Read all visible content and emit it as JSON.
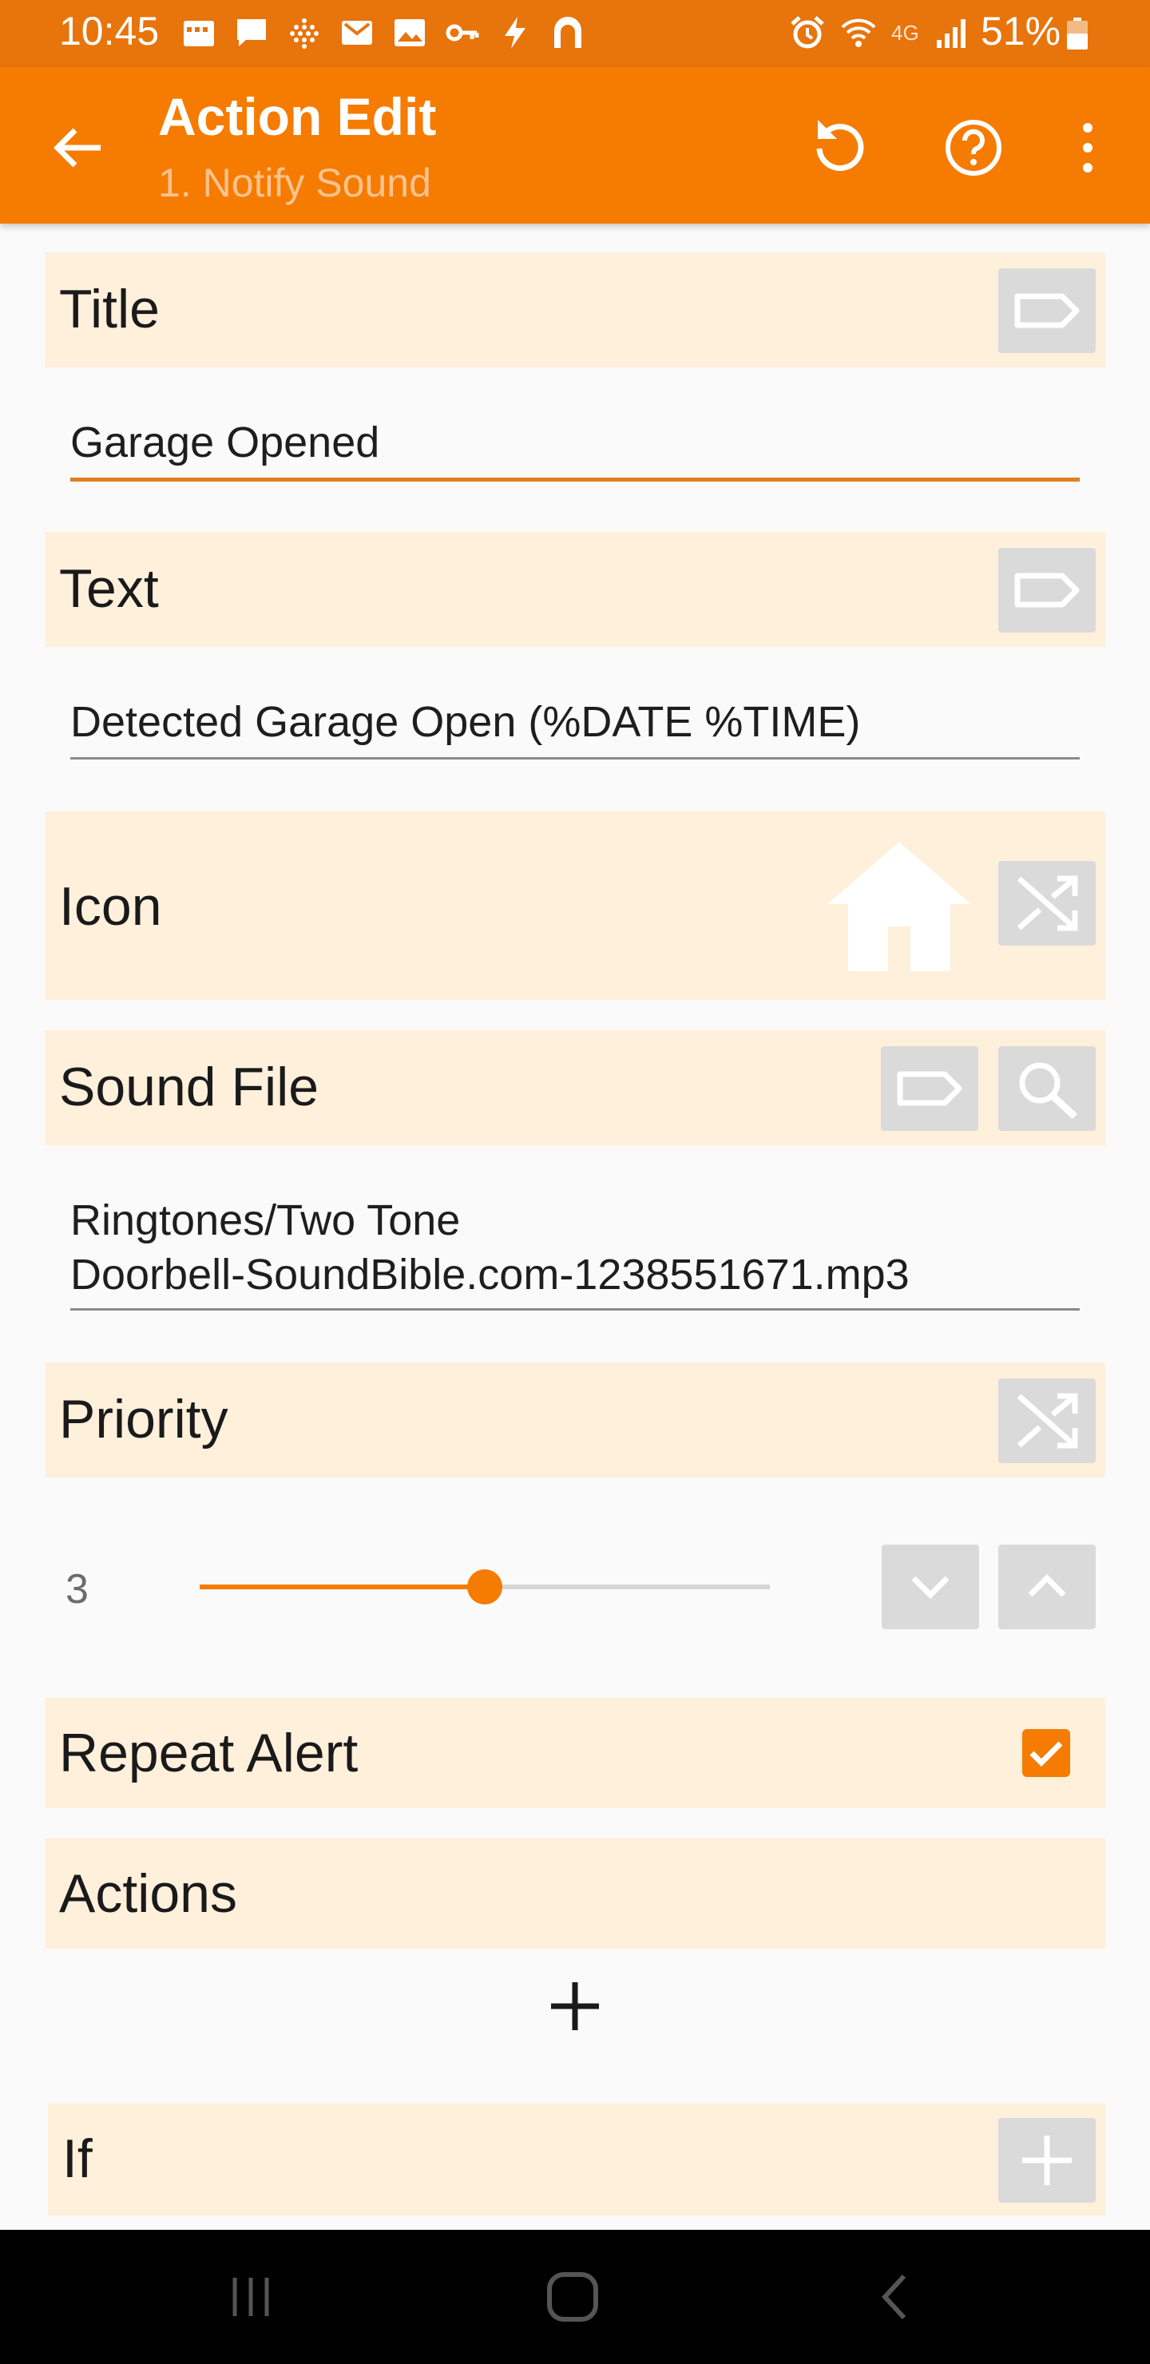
{
  "status_bar": {
    "time": "10:45",
    "battery": "51%",
    "network": "4G"
  },
  "app_bar": {
    "title": "Action Edit",
    "subtitle": "1. Notify Sound"
  },
  "sections": {
    "title": {
      "label": "Title",
      "value": "Garage Opened"
    },
    "text": {
      "label": "Text",
      "value": "Detected Garage Open (%DATE %TIME)"
    },
    "icon": {
      "label": "Icon",
      "icon_name": "home-icon"
    },
    "sound_file": {
      "label": "Sound File",
      "value_line1": "Ringtones/Two Tone",
      "value_line2": "Doorbell-SoundBible.com-1238551671.mp3"
    },
    "priority": {
      "label": "Priority",
      "value": "3",
      "slider_min": 0,
      "slider_max": 6,
      "slider_value": 3
    },
    "repeat_alert": {
      "label": "Repeat Alert",
      "checked": true
    },
    "actions": {
      "label": "Actions",
      "add_symbol": "+"
    },
    "if": {
      "label": "If"
    }
  },
  "colors": {
    "accent": "#f57c00",
    "status_bar": "#e8740c",
    "section_bg": "#fff0dc",
    "button_bg": "#dadada"
  }
}
